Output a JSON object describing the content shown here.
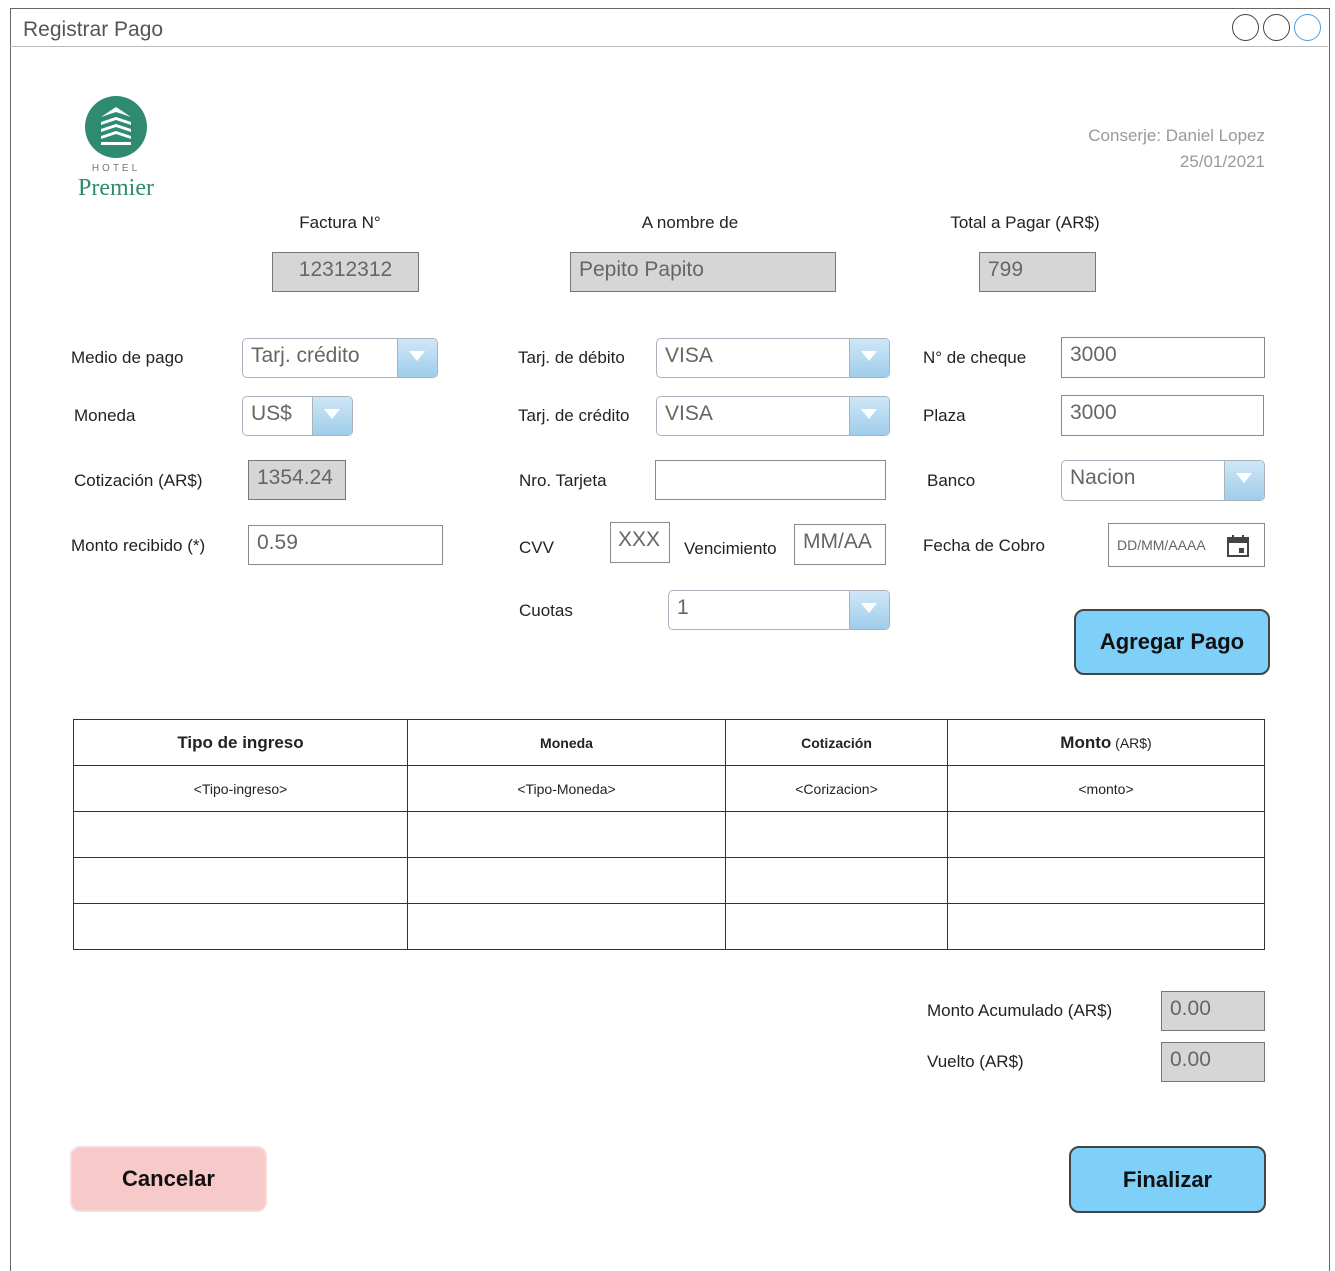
{
  "window": {
    "title": "Registrar Pago"
  },
  "logo": {
    "hotel_word": "HOTEL",
    "brand": "Premier",
    "brand_color": "#2e8b6f"
  },
  "header": {
    "conserje": "Conserje: Daniel Lopez",
    "date": "25/01/2021"
  },
  "invoice": {
    "factura_label": "Factura N°",
    "factura_value": "12312312",
    "nombre_label": "A nombre de",
    "nombre_value": "Pepito Papito",
    "total_label": "Total a Pagar (AR$)",
    "total_value": "799"
  },
  "col1": {
    "medio_label": "Medio de pago",
    "medio_value": "Tarj. crédito",
    "moneda_label": "Moneda",
    "moneda_value": "US$",
    "cotizacion_label": "Cotización (AR$)",
    "cotizacion_value": "1354.24",
    "monto_label": "Monto recibido (*)",
    "monto_value": "0.59"
  },
  "col2": {
    "debito_label": "Tarj. de débito",
    "debito_value": "VISA",
    "credito_label": "Tarj. de crédito",
    "credito_value": "VISA",
    "nro_label": "Nro. Tarjeta",
    "nro_value": "",
    "cvv_label": "CVV",
    "cvv_placeholder": "XXX",
    "venc_label": "Vencimiento",
    "venc_placeholder": "MM/AA",
    "cuotas_label": "Cuotas",
    "cuotas_value": "1"
  },
  "col3": {
    "cheque_label": "N° de cheque",
    "cheque_value": "3000",
    "plaza_label": "Plaza",
    "plaza_value": "3000",
    "banco_label": "Banco",
    "banco_value": "Nacion",
    "fecha_label": "Fecha de Cobro",
    "fecha_placeholder": "DD/MM/AAAA"
  },
  "actions": {
    "agregar": "Agregar Pago",
    "cancelar": "Cancelar",
    "finalizar": "Finalizar"
  },
  "table": {
    "headers": [
      "Tipo de ingreso",
      "Moneda",
      "Cotización",
      "Monto"
    ],
    "monto_unit": "(AR$)",
    "row": [
      "<Tipo-ingreso>",
      "<Tipo-Moneda>",
      "<Corizacion>",
      "<monto>"
    ]
  },
  "totals": {
    "acumulado_label": "Monto Acumulado (AR$)",
    "acumulado_value": "0.00",
    "vuelto_label": "Vuelto (AR$)",
    "vuelto_value": "0.00"
  }
}
